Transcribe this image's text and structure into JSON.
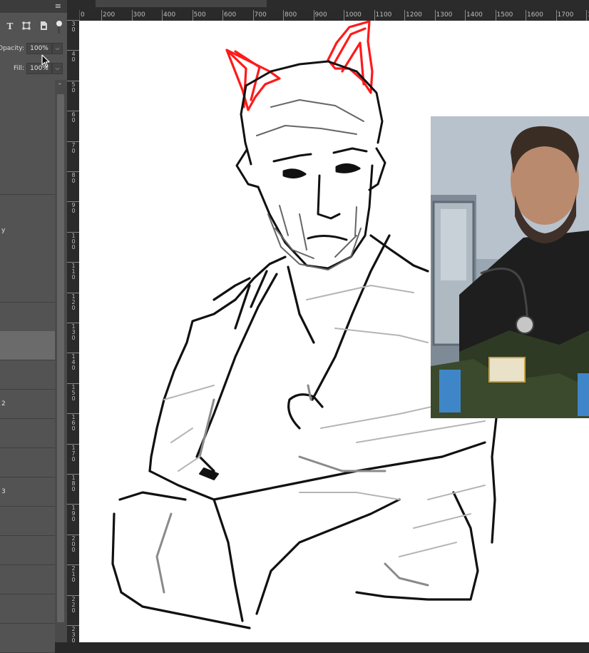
{
  "panel": {
    "menu_icon": "panel-menu-icon",
    "filter_icons": [
      "type-layer-filter-icon",
      "shape-layer-filter-icon",
      "smart-object-filter-icon",
      "filter-toggle-icon"
    ],
    "opacity": {
      "label": "Opacity:",
      "value": "100%"
    },
    "fill": {
      "label": "Fill:",
      "value": "100%"
    },
    "layers": [
      {
        "label": ""
      },
      {
        "label": ""
      },
      {
        "label": ""
      },
      {
        "label": ""
      },
      {
        "label": "y"
      },
      {
        "label": ""
      },
      {
        "label": ""
      },
      {
        "label": "",
        "selected": true
      },
      {
        "label": ""
      },
      {
        "label": "2"
      },
      {
        "label": ""
      },
      {
        "label": ""
      },
      {
        "label": "3"
      },
      {
        "label": ""
      },
      {
        "label": ""
      },
      {
        "label": ""
      },
      {
        "label": ""
      },
      {
        "label": ""
      },
      {
        "label": ""
      }
    ]
  },
  "rulers": {
    "horizontal": [
      "0",
      "200",
      "300",
      "400",
      "500",
      "600",
      "700",
      "800",
      "900",
      "1000",
      "1100",
      "1200",
      "1300",
      "1400",
      "1500",
      "1600",
      "1700",
      "18"
    ],
    "vertical": [
      "3 0",
      "4 0",
      "5 0",
      "6 0",
      "7 0",
      "8 0",
      "9 0",
      "1 0 0",
      "1 1 0",
      "1 2 0",
      "1 3 0",
      "1 4 0",
      "1 5 0",
      "1 6 0",
      "1 7 0",
      "1 8 0",
      "1 9 0",
      "2 0 0",
      "2 1 0",
      "2 2 0",
      "2 3 0"
    ]
  },
  "canvas": {
    "content": "sketch-drawing",
    "reference": "reference-photo"
  },
  "colors": {
    "ears": "#ff1a1a",
    "sketch": "#111111",
    "panel": "#535353"
  }
}
